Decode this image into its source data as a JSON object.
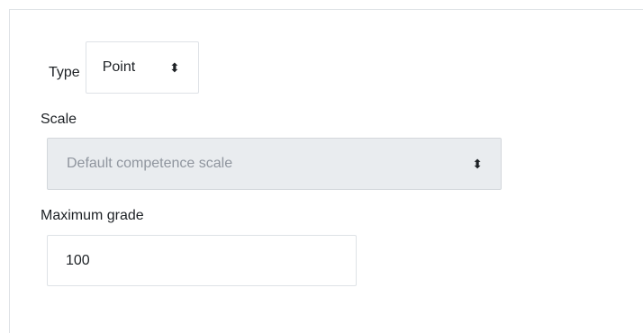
{
  "grade": {
    "type_label": "Type",
    "type_value": "Point",
    "scale_label": "Scale",
    "scale_value": "Default competence scale",
    "max_grade_label": "Maximum grade",
    "max_grade_value": "100"
  },
  "icons": {
    "type_select_arrows": "up-down-caret-icon",
    "scale_select_arrows": "up-down-caret-icon"
  }
}
